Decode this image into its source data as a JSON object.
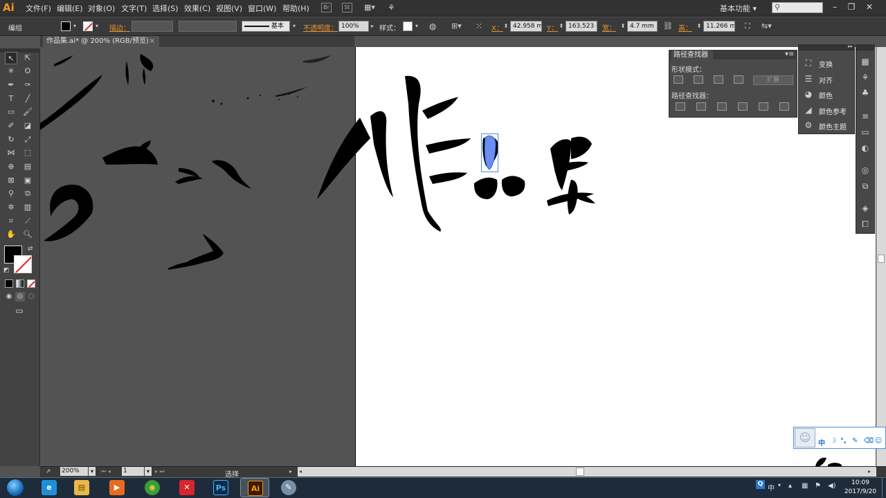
{
  "app": {
    "logo": "Ai"
  },
  "menu": [
    "文件(F)",
    "编辑(E)",
    "对象(O)",
    "文字(T)",
    "选择(S)",
    "效果(C)",
    "视图(V)",
    "窗口(W)",
    "帮助(H)"
  ],
  "menubar_icons": {
    "bridge": "Br",
    "stock": "St"
  },
  "workspace": {
    "label": "基本功能 ▾"
  },
  "search": {
    "placeholder": ""
  },
  "control_bar": {
    "selection_label": "编组",
    "stroke_label": "描边：",
    "stroke_style": "基本",
    "opacity_label": "不透明度：",
    "opacity_value": "100%",
    "style_label": "样式：",
    "x_label": "X：",
    "x_value": "42.958 mm",
    "y_label": "Y：",
    "y_value": "163.523 m",
    "w_label": "宽：",
    "w_value": "4.7 mm",
    "h_label": "高：",
    "h_value": "11.266 mm"
  },
  "document_tab": {
    "title": "作品集.ai* @ 200% (RGB/预览)",
    "close": "×"
  },
  "pathfinder": {
    "title": "路径查找器",
    "shape_modes_label": "形状模式：",
    "pathfinders_label": "路径查找器：",
    "expand_label": "扩展"
  },
  "dock_panels": [
    {
      "label": "变换",
      "icon": "transform-icon"
    },
    {
      "label": "对齐",
      "icon": "align-icon"
    },
    {
      "label": "颜色",
      "icon": "color-palette-icon"
    },
    {
      "label": "颜色参考",
      "icon": "color-guide-icon"
    },
    {
      "label": "颜色主题",
      "icon": "color-themes-icon"
    }
  ],
  "status": {
    "zoom": "200%",
    "page": "1",
    "tool": "选择"
  },
  "ime": {
    "mode": "中",
    "moon": "☽",
    "dots": "°,",
    "wrench": "✎",
    "trash": "⌫",
    "smile": "☺"
  },
  "taskbar": {
    "apps": [
      {
        "name": "ie",
        "glyph": "e",
        "bg": "#1f8fd8"
      },
      {
        "name": "explorer",
        "glyph": "▤",
        "bg": "#e9b94a"
      },
      {
        "name": "media",
        "glyph": "▶",
        "bg": "#e66a1f"
      },
      {
        "name": "chrome",
        "glyph": "◉",
        "bg": "#3a9c3a"
      },
      {
        "name": "xmind",
        "glyph": "✕",
        "bg": "#d8262c"
      },
      {
        "name": "photoshop",
        "glyph": "Ps",
        "bg": "#0b2c4a"
      },
      {
        "name": "illustrator",
        "glyph": "Ai",
        "bg": "#3a1a00"
      },
      {
        "name": "paint",
        "glyph": "✎",
        "bg": "#7a8ea6"
      }
    ],
    "tray_ime": "Q",
    "tray_lang": "中",
    "clock_time": "10:09",
    "clock_date": "2017/9/20"
  },
  "colors": {
    "accent_orange": "#e8932b",
    "selection_blue": "#4a8ed8",
    "ink": "#000000"
  }
}
